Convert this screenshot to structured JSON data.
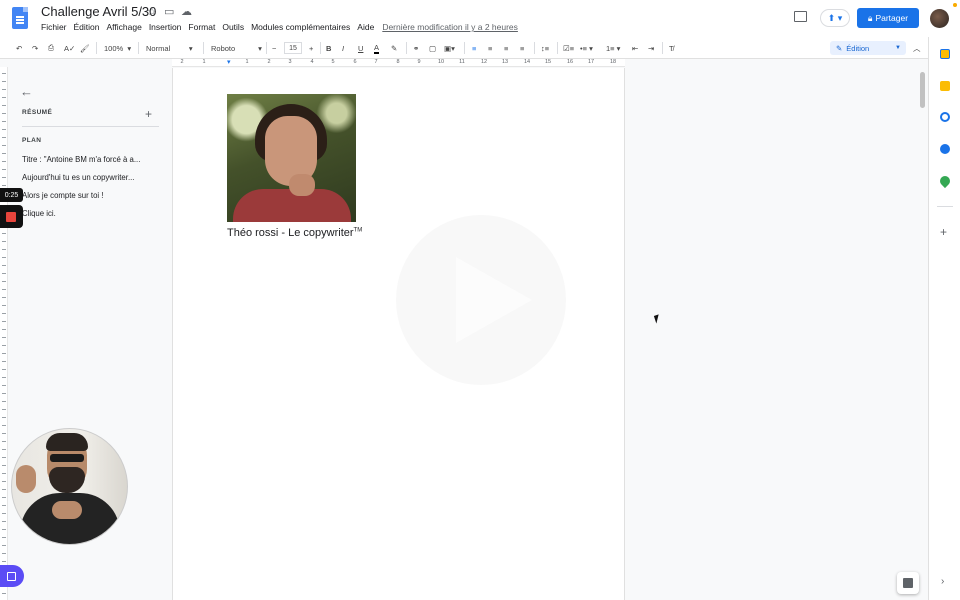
{
  "header": {
    "doc_title": "Challenge Avril 5/30",
    "menu": [
      "Fichier",
      "Édition",
      "Affichage",
      "Insertion",
      "Format",
      "Outils",
      "Modules complémentaires",
      "Aide"
    ],
    "last_modified": "Dernière modification il y a 2 heures",
    "share_label": "Partager"
  },
  "toolbar": {
    "zoom": "100%",
    "style": "Normal",
    "font": "Roboto",
    "font_size": "15",
    "mode_label": "Édition"
  },
  "ruler": {
    "numbers": [
      "2",
      "1",
      "1",
      "2",
      "3",
      "4",
      "5",
      "6",
      "7",
      "8",
      "9",
      "10",
      "11",
      "12",
      "13",
      "14",
      "15",
      "16",
      "17",
      "18"
    ]
  },
  "outline": {
    "summary_heading": "RÉSUMÉ",
    "plan_heading": "PLAN",
    "items": [
      "Titre : \"Antoine BM m'a forcé à a...",
      "Aujourd'hui tu es un copywriter...",
      "Alors je compte sur toi !",
      "Clique ici."
    ]
  },
  "document": {
    "caption": "Théo rossi - Le copywriter",
    "caption_tm": "TM"
  },
  "recorder": {
    "timer": "0:25"
  },
  "colors": {
    "accent": "#1a73e8",
    "record_red": "#e8453c",
    "cam_purple": "#5b4cf5"
  }
}
